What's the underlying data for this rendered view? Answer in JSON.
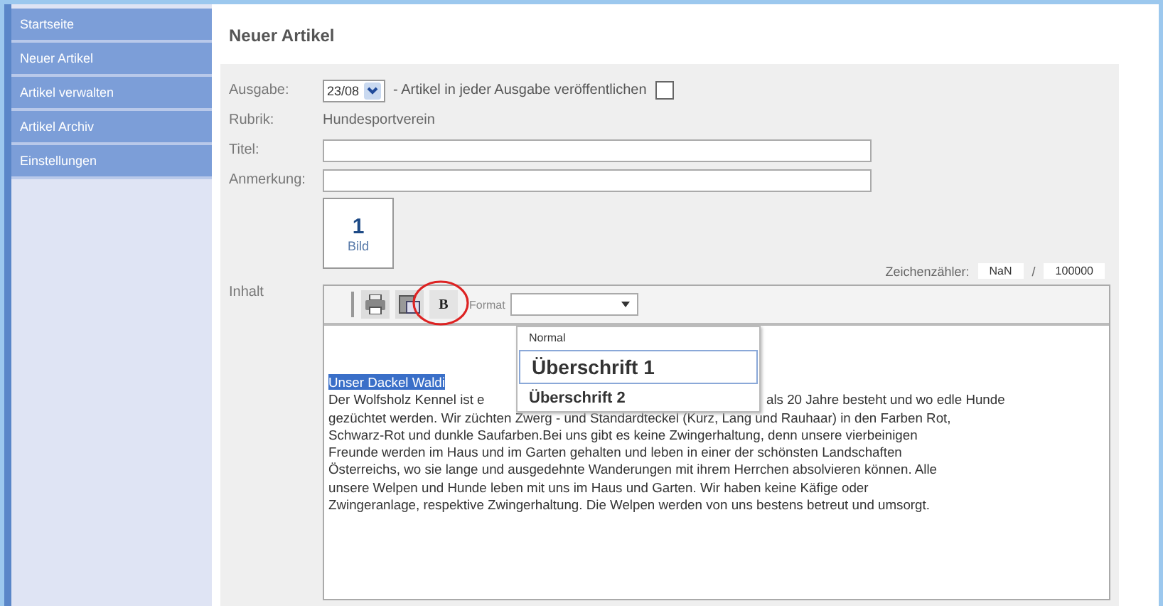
{
  "sidebar": {
    "items": [
      {
        "label": "Startseite"
      },
      {
        "label": "Neuer Artikel"
      },
      {
        "label": "Artikel verwalten"
      },
      {
        "label": "Artikel Archiv"
      },
      {
        "label": "Einstellungen"
      }
    ]
  },
  "page_title": "Neuer Artikel",
  "form": {
    "ausgabe": {
      "label": "Ausgabe:",
      "value": "23/08",
      "note": "- Artikel in jeder Ausgabe veröffentlichen",
      "checked": false
    },
    "rubrik": {
      "label": "Rubrik:",
      "value": "Hundesportverein"
    },
    "titel": {
      "label": "Titel:"
    },
    "anmerkung": {
      "label": "Anmerkung:"
    },
    "images": {
      "count": "1",
      "label": "Bild"
    },
    "counter": {
      "label": "Zeichenzähler:",
      "value": "NaN",
      "separator": "/",
      "max": "100000"
    }
  },
  "editor": {
    "label": "Inhalt",
    "toolbar": {
      "bold": "B",
      "format_label": "Format"
    },
    "format_menu": [
      {
        "label": "Normal",
        "kind": "normal",
        "selected": false
      },
      {
        "label": "Überschrift 1",
        "kind": "h1",
        "selected": true
      },
      {
        "label": "Überschrift 2",
        "kind": "h2",
        "selected": false
      }
    ],
    "content": {
      "selected_text": "Unser Dackel Waldi",
      "first_line_left": "Der Wolfsholz Kennel ist e",
      "first_line_right": "als 20 Jahre besteht und wo edle Hunde",
      "lines": [
        "gezüchtet werden. Wir züchten Zwerg - und Standardteckel (Kurz, Lang und Rauhaar) in den Farben Rot,",
        "Schwarz-Rot und dunkle Saufarben.Bei uns gibt es keine Zwingerhaltung, denn unsere vierbeinigen",
        "Freunde werden im Haus und im Garten gehalten und leben in einer der schönsten Landschaften",
        "Österreichs, wo sie lange und ausgedehnte Wanderungen mit ihrem Herrchen absolvieren können. Alle",
        "unsere Welpen und Hunde leben mit uns im Haus und Garten. Wir haben keine Käfige oder",
        "Zwingeranlage, respektive Zwingerhaltung. Die Welpen werden von uns bestens betreut und umsorgt."
      ]
    }
  }
}
